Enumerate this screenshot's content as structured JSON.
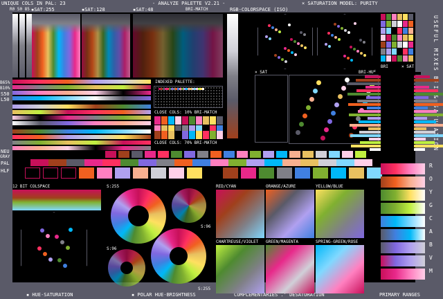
{
  "header": {
    "unique_cols": "UNIQUE COLS IN PAL: 23",
    "title": "- ANALYZE PALETTE V2.21 -",
    "sat_model": "× SATURATION MODEL: PURITY"
  },
  "top_labels": {
    "modes": "R0 50 85",
    "sat255": "▪SAT:255",
    "sat128": "▪SAT:128",
    "sat48": "▪SAT:48",
    "bri_match": "BRI-MATCH",
    "rgb": "RGB-COLORSPACE (ISO)"
  },
  "side_labels": {
    "b65": "B65%",
    "b10": "B10%",
    "s50": "S50",
    "l50": "L50",
    "neu": "NEU",
    "gray": "GRAY",
    "pal": "PAL",
    "hlf": "HLF"
  },
  "right_labels": {
    "useful_mixes": "USEFUL MIXES",
    "bri_sat": "BRI & SATURATION",
    "ranges": [
      "R",
      "O",
      "Y",
      "G",
      "C",
      "A",
      "B",
      "V",
      "M"
    ]
  },
  "panels": {
    "indexed_palette": "INDEXED PALETTE:",
    "close10": "CLOSE COLS: 10% BRI-MATCH",
    "close70": "CLOSE COLS: 70% BRI-MATCH",
    "x_sat": "× SAT",
    "bri_hue": "BRI-HUE",
    "bri": "BRI",
    "x_sat2": "× SAT",
    "colspace12": "12 BIT COLSPACE",
    "s255a": "S:255",
    "s96a": "S:96",
    "s96b": "S:96",
    "s255b": "S:255",
    "red_cyan": "RED/CYAN",
    "orange_azure": "ORANGE/AZURE",
    "yellow_blue": "YELLOW/BLUE",
    "chartreuse_violet": "CHARTREUSE/VIOLET",
    "green_magenta": "GREEN/MAGENTA",
    "spring_rose": "SPRING-GREEN/ROSE"
  },
  "footer": {
    "hue_sat": "▪ HUE-SATURATION",
    "polar": "▪ POLAR HUE-BRIGHTNESS",
    "comp": "COMPLEMENTARIES .' DESATURATION",
    "ranges": "PRIMARY RANGES"
  },
  "palette": [
    "#000000",
    "#c8105a",
    "#a0401c",
    "#5a5a68",
    "#e8288a",
    "#ff3060",
    "#4e8a30",
    "#8068e0",
    "#808088",
    "#f06020",
    "#4080e0",
    "#ff80c0",
    "#80b030",
    "#b0a0f0",
    "#00b8f8",
    "#f8b090",
    "#e8c060",
    "#d0d0d8",
    "#80d8ff",
    "#ffd0e8",
    "#c0f040",
    "#ffe060",
    "#ffffff"
  ],
  "colors": {
    "bg": "#5a5a68",
    "canvas": "#000000",
    "accent": "#c8105a"
  }
}
